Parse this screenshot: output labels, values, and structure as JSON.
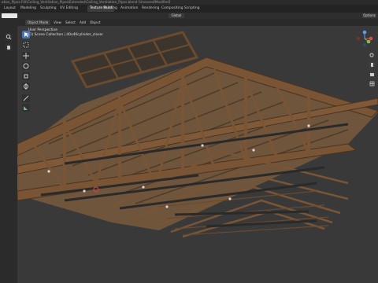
{
  "window": {
    "title": "ation_Pipes FIX\\Ceiling_Ventilation_Pipes\\Extended\\Ceiling_Ventilation_Pipes.blend [Unsaved/Modified]"
  },
  "workspaces": [
    {
      "label": "Layout"
    },
    {
      "label": "Modeling"
    },
    {
      "label": "Sculpting"
    },
    {
      "label": "UV Editing"
    },
    {
      "label": "Texture Paint"
    },
    {
      "label": "Shading"
    },
    {
      "label": "Animation"
    },
    {
      "label": "Rendering"
    },
    {
      "label": "Compositing"
    },
    {
      "label": "Scripting"
    }
  ],
  "active_workspace": "Texture Paint",
  "top": {
    "scene_label": "View",
    "transform": "Global",
    "options": "Options"
  },
  "viewport_header": {
    "mode": "Object Mode",
    "menus": [
      "View",
      "Select",
      "Add",
      "Object"
    ]
  },
  "overlay": {
    "view_name": "User Perspective",
    "collection": "(1) Scene Collection | 40x40cylinder_closer"
  },
  "colors": {
    "accent": "#4772b3",
    "wood": "#7a5535",
    "metal": "#2a2a2a",
    "bg": "#393939"
  },
  "nav_gizmo": {
    "x": "X",
    "y": "Y",
    "z": "Z"
  },
  "icons": [
    "cursor-icon",
    "move-icon",
    "rotate-icon",
    "scale-icon",
    "transform-icon",
    "annotate-icon",
    "measure-icon",
    "zoom-icon",
    "hand-icon",
    "camera-icon",
    "grid-icon"
  ]
}
